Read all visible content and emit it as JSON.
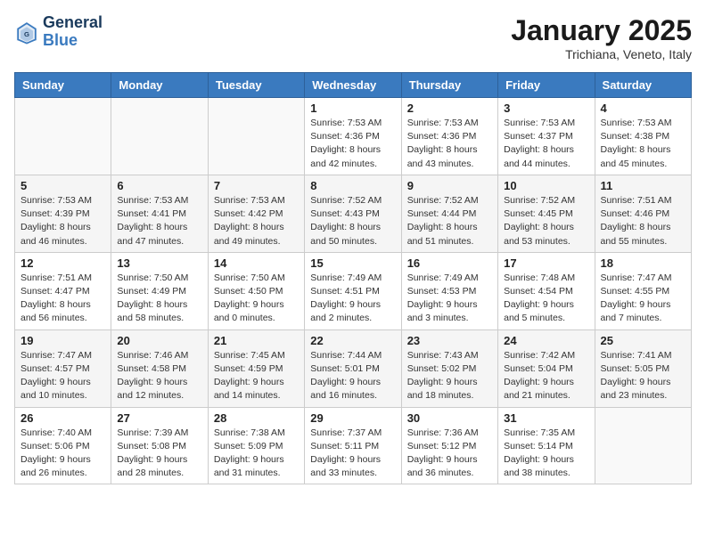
{
  "header": {
    "logo_line1": "General",
    "logo_line2": "Blue",
    "month": "January 2025",
    "location": "Trichiana, Veneto, Italy"
  },
  "weekdays": [
    "Sunday",
    "Monday",
    "Tuesday",
    "Wednesday",
    "Thursday",
    "Friday",
    "Saturday"
  ],
  "weeks": [
    [
      {
        "day": "",
        "info": ""
      },
      {
        "day": "",
        "info": ""
      },
      {
        "day": "",
        "info": ""
      },
      {
        "day": "1",
        "info": "Sunrise: 7:53 AM\nSunset: 4:36 PM\nDaylight: 8 hours and 42 minutes."
      },
      {
        "day": "2",
        "info": "Sunrise: 7:53 AM\nSunset: 4:36 PM\nDaylight: 8 hours and 43 minutes."
      },
      {
        "day": "3",
        "info": "Sunrise: 7:53 AM\nSunset: 4:37 PM\nDaylight: 8 hours and 44 minutes."
      },
      {
        "day": "4",
        "info": "Sunrise: 7:53 AM\nSunset: 4:38 PM\nDaylight: 8 hours and 45 minutes."
      }
    ],
    [
      {
        "day": "5",
        "info": "Sunrise: 7:53 AM\nSunset: 4:39 PM\nDaylight: 8 hours and 46 minutes."
      },
      {
        "day": "6",
        "info": "Sunrise: 7:53 AM\nSunset: 4:41 PM\nDaylight: 8 hours and 47 minutes."
      },
      {
        "day": "7",
        "info": "Sunrise: 7:53 AM\nSunset: 4:42 PM\nDaylight: 8 hours and 49 minutes."
      },
      {
        "day": "8",
        "info": "Sunrise: 7:52 AM\nSunset: 4:43 PM\nDaylight: 8 hours and 50 minutes."
      },
      {
        "day": "9",
        "info": "Sunrise: 7:52 AM\nSunset: 4:44 PM\nDaylight: 8 hours and 51 minutes."
      },
      {
        "day": "10",
        "info": "Sunrise: 7:52 AM\nSunset: 4:45 PM\nDaylight: 8 hours and 53 minutes."
      },
      {
        "day": "11",
        "info": "Sunrise: 7:51 AM\nSunset: 4:46 PM\nDaylight: 8 hours and 55 minutes."
      }
    ],
    [
      {
        "day": "12",
        "info": "Sunrise: 7:51 AM\nSunset: 4:47 PM\nDaylight: 8 hours and 56 minutes."
      },
      {
        "day": "13",
        "info": "Sunrise: 7:50 AM\nSunset: 4:49 PM\nDaylight: 8 hours and 58 minutes."
      },
      {
        "day": "14",
        "info": "Sunrise: 7:50 AM\nSunset: 4:50 PM\nDaylight: 9 hours and 0 minutes."
      },
      {
        "day": "15",
        "info": "Sunrise: 7:49 AM\nSunset: 4:51 PM\nDaylight: 9 hours and 2 minutes."
      },
      {
        "day": "16",
        "info": "Sunrise: 7:49 AM\nSunset: 4:53 PM\nDaylight: 9 hours and 3 minutes."
      },
      {
        "day": "17",
        "info": "Sunrise: 7:48 AM\nSunset: 4:54 PM\nDaylight: 9 hours and 5 minutes."
      },
      {
        "day": "18",
        "info": "Sunrise: 7:47 AM\nSunset: 4:55 PM\nDaylight: 9 hours and 7 minutes."
      }
    ],
    [
      {
        "day": "19",
        "info": "Sunrise: 7:47 AM\nSunset: 4:57 PM\nDaylight: 9 hours and 10 minutes."
      },
      {
        "day": "20",
        "info": "Sunrise: 7:46 AM\nSunset: 4:58 PM\nDaylight: 9 hours and 12 minutes."
      },
      {
        "day": "21",
        "info": "Sunrise: 7:45 AM\nSunset: 4:59 PM\nDaylight: 9 hours and 14 minutes."
      },
      {
        "day": "22",
        "info": "Sunrise: 7:44 AM\nSunset: 5:01 PM\nDaylight: 9 hours and 16 minutes."
      },
      {
        "day": "23",
        "info": "Sunrise: 7:43 AM\nSunset: 5:02 PM\nDaylight: 9 hours and 18 minutes."
      },
      {
        "day": "24",
        "info": "Sunrise: 7:42 AM\nSunset: 5:04 PM\nDaylight: 9 hours and 21 minutes."
      },
      {
        "day": "25",
        "info": "Sunrise: 7:41 AM\nSunset: 5:05 PM\nDaylight: 9 hours and 23 minutes."
      }
    ],
    [
      {
        "day": "26",
        "info": "Sunrise: 7:40 AM\nSunset: 5:06 PM\nDaylight: 9 hours and 26 minutes."
      },
      {
        "day": "27",
        "info": "Sunrise: 7:39 AM\nSunset: 5:08 PM\nDaylight: 9 hours and 28 minutes."
      },
      {
        "day": "28",
        "info": "Sunrise: 7:38 AM\nSunset: 5:09 PM\nDaylight: 9 hours and 31 minutes."
      },
      {
        "day": "29",
        "info": "Sunrise: 7:37 AM\nSunset: 5:11 PM\nDaylight: 9 hours and 33 minutes."
      },
      {
        "day": "30",
        "info": "Sunrise: 7:36 AM\nSunset: 5:12 PM\nDaylight: 9 hours and 36 minutes."
      },
      {
        "day": "31",
        "info": "Sunrise: 7:35 AM\nSunset: 5:14 PM\nDaylight: 9 hours and 38 minutes."
      },
      {
        "day": "",
        "info": ""
      }
    ]
  ]
}
